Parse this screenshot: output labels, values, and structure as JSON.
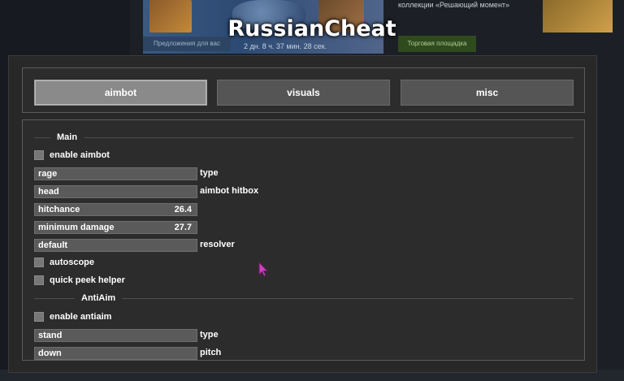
{
  "background": {
    "promo_text": "Предложения для вас",
    "timer_text": "2 дн.  8 ч.  37 мин.  28 сек.",
    "market_text": "Торговая площадка",
    "collection_text": "коллекции «Решающий момент»"
  },
  "window": {
    "title": "RussianCheat"
  },
  "tabs": [
    {
      "label": "aimbot",
      "active": true
    },
    {
      "label": "visuals",
      "active": false
    },
    {
      "label": "misc",
      "active": false
    }
  ],
  "main_section": {
    "title": "Main"
  },
  "antiaim_section": {
    "title": "AntiAim"
  },
  "controls": {
    "enable_aimbot": {
      "label": "enable aimbot",
      "checked": false
    },
    "type_select": {
      "value": "rage",
      "caption": "type"
    },
    "hitbox_select": {
      "value": "head",
      "caption": "aimbot hitbox"
    },
    "hitchance": {
      "label": "hitchance",
      "value": "26.4"
    },
    "min_damage": {
      "label": "minimum damage",
      "value": "27.7"
    },
    "resolver_select": {
      "value": "default",
      "caption": "resolver"
    },
    "autoscope": {
      "label": "autoscope",
      "checked": false
    },
    "quick_peek": {
      "label": "quick peek helper",
      "checked": false
    },
    "enable_antiaim": {
      "label": "enable antiaim",
      "checked": false
    },
    "stand_select": {
      "value": "stand",
      "caption": "type"
    },
    "pitch_select": {
      "value": "down",
      "caption": "pitch"
    }
  },
  "colors": {
    "panel_bg": "#282828",
    "control_fill": "#5a5a5a",
    "active_tab": "#8a8a8a",
    "cursor": "#d040c0"
  }
}
